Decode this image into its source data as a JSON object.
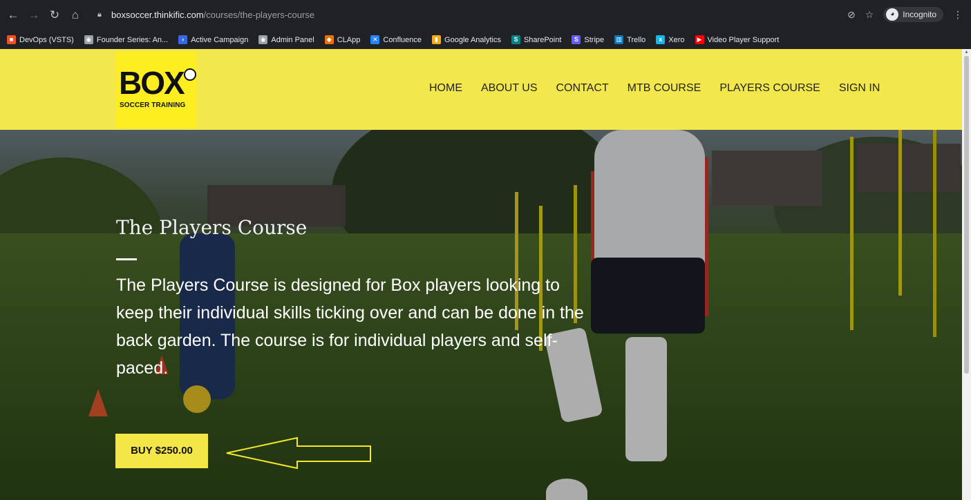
{
  "browser": {
    "url_host": "boxsoccer.thinkific.com",
    "url_path": "/courses/the-players-course",
    "incognito_label": "Incognito",
    "bookmarks": [
      {
        "label": "DevOps (VSTS)",
        "icon": "windows-icon",
        "color": "#f25022"
      },
      {
        "label": "Founder Series: An...",
        "icon": "globe-icon",
        "color": "#9aa0a6"
      },
      {
        "label": "Active Campaign",
        "icon": "activecampaign-icon",
        "color": "#356ae6"
      },
      {
        "label": "Admin Panel",
        "icon": "globe-icon",
        "color": "#9aa0a6"
      },
      {
        "label": "CLApp",
        "icon": "clapp-icon",
        "color": "#e8710a"
      },
      {
        "label": "Confluence",
        "icon": "confluence-icon",
        "color": "#2684ff"
      },
      {
        "label": "Google Analytics",
        "icon": "analytics-icon",
        "color": "#f9ab00"
      },
      {
        "label": "SharePoint",
        "icon": "sharepoint-icon",
        "color": "#038387"
      },
      {
        "label": "Stripe",
        "icon": "stripe-icon",
        "color": "#635bff"
      },
      {
        "label": "Trello",
        "icon": "trello-icon",
        "color": "#0079bf"
      },
      {
        "label": "Xero",
        "icon": "xero-icon",
        "color": "#13b5ea"
      },
      {
        "label": "Video Player Support",
        "icon": "youtube-icon",
        "color": "#ff0000"
      }
    ]
  },
  "site": {
    "logo_main": "BOX",
    "logo_sub": "SOCCER TRAINING",
    "nav": [
      "HOME",
      "ABOUT US",
      "CONTACT",
      "MTB COURSE",
      "PLAYERS COURSE",
      "SIGN IN"
    ]
  },
  "hero": {
    "title": "The Players Course",
    "description": "The Players Course is designed for Box players looking to keep their individual skills ticking over and can be done in the back garden. The course is for individual players and self-paced.",
    "buy_label": "BUY $250.00"
  },
  "colors": {
    "header_yellow": "#f2e84e",
    "button_yellow": "#f3e647",
    "annotation_arrow": "#f5e72a"
  }
}
